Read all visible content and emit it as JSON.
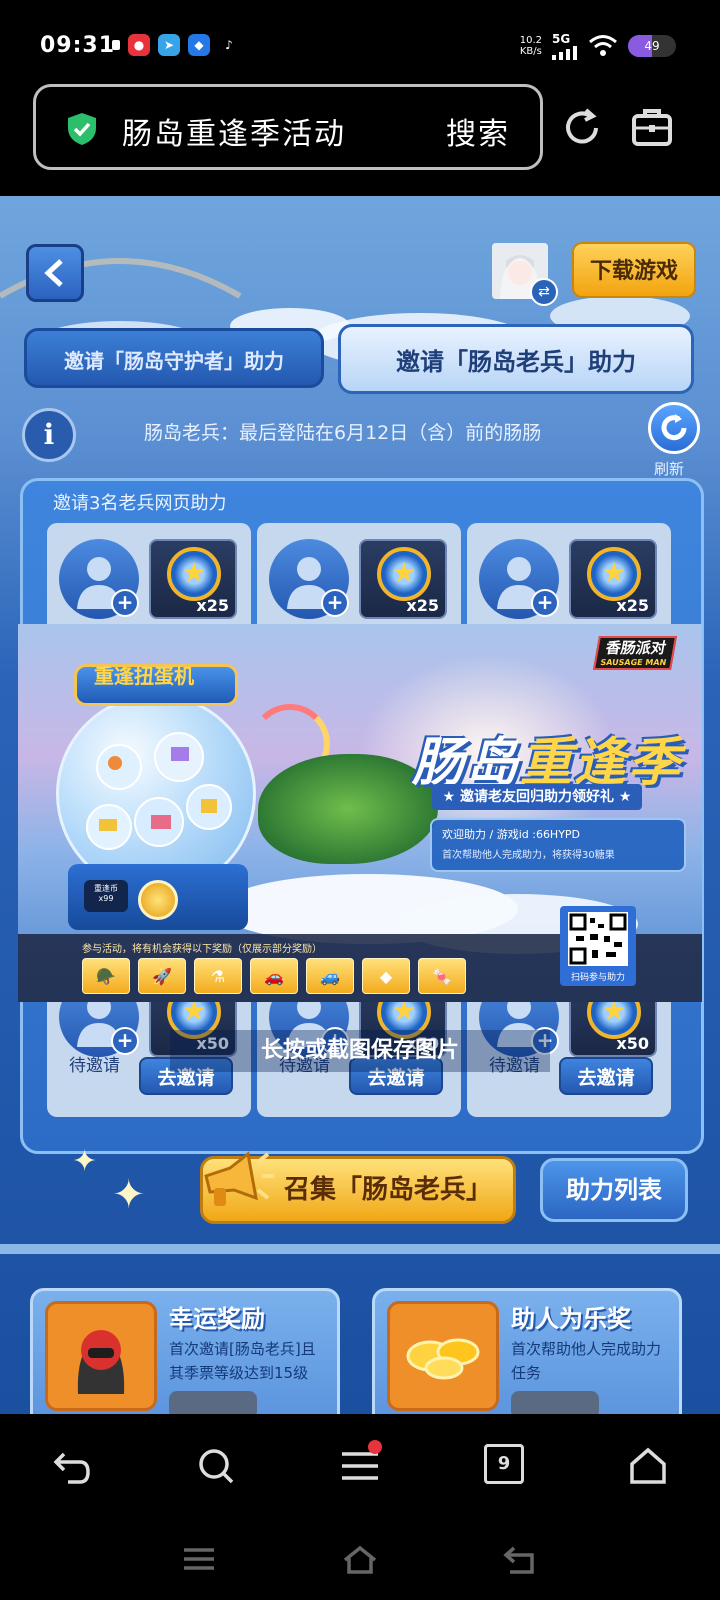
{
  "status_bar": {
    "time": "09:31",
    "net_speed_value": "10.2",
    "net_speed_unit": "KB/s",
    "network": "5G",
    "battery": "49",
    "battery_level": 0.49
  },
  "browser": {
    "address_title": "肠岛重逢季活动",
    "search_label": "搜索"
  },
  "page": {
    "download_button": "下载游戏",
    "tabs": [
      {
        "label": "邀请「肠岛守护者」助力",
        "active": false
      },
      {
        "label": "邀请「肠岛老兵」助力",
        "active": true
      }
    ],
    "info_icon_glyph": "i",
    "veteran_note": "肠岛老兵：最后登陆在6月12日（含）前的肠肠",
    "refresh_label": "刷新",
    "panel_title": "邀请3名老兵网页助力",
    "top_slots": [
      {
        "reward_qty": "x25"
      },
      {
        "reward_qty": "x25"
      },
      {
        "reward_qty": "x25"
      }
    ],
    "bottom_slots": [
      {
        "status": "待邀请",
        "reward_qty": "x50",
        "button": "去邀请"
      },
      {
        "status": "待邀请",
        "reward_qty": "x50",
        "button": "去邀请"
      },
      {
        "status": "待邀请",
        "reward_qty": "x50",
        "button": "去邀请"
      }
    ],
    "save_hint": "长按或截图保存图片",
    "summon_button": "召集「肠岛老兵」",
    "assist_list_button": "助力列表",
    "reward_cards": [
      {
        "title": "幸运奖励",
        "desc": "首次邀请[肠岛老兵]且其季票等级达到15级"
      },
      {
        "title": "助人为乐奖",
        "desc": "首次帮助他人完成助力任务"
      }
    ]
  },
  "poster": {
    "gacha_title": "重逢扭蛋机",
    "gacha_screen_label": "重逢币",
    "gacha_screen_qty": "x99",
    "brand_name": "香肠派对",
    "brand_sub": "SAUSAGE MAN",
    "title_part1": "肠岛",
    "title_part2": "重逢季",
    "subtitle": "★ 邀请老友回归助力领好礼 ★",
    "help_line1": "欢迎助力 / 游戏id :66HYPD",
    "help_line2": "首次帮助他人完成助力，将获得30糖果",
    "reward_caption": "参与活动，将有机会获得以下奖励（仅展示部分奖励）",
    "qr_label": "扫码参与助力"
  },
  "colors": {
    "accent_gold": "#f2a40f",
    "primary_blue": "#2b63bd",
    "notification_dot": "#e8333c"
  },
  "nav": {
    "tab_count": "9"
  }
}
